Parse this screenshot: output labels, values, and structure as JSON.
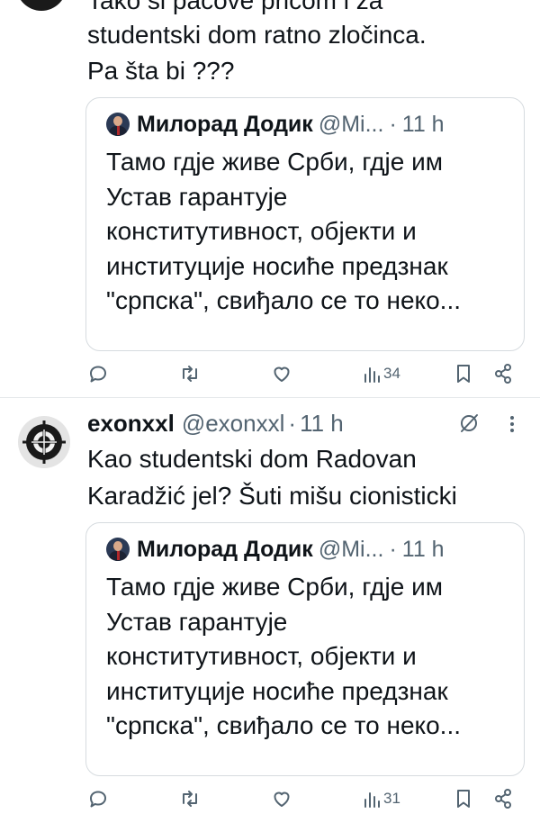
{
  "tweet1": {
    "text_lines": [
      "Tako si pacove pricom i za",
      "studentski dom ratno zločinca.",
      "Pa šta bi ???"
    ],
    "quote": {
      "name": "Милорад Додик",
      "handle": "@Mi...",
      "dot": "·",
      "time": "11 h",
      "lines": [
        "Тамо гдје живе Срби, гдје им",
        "Устав гарантује",
        "конститутивност, објекти и",
        "институције носиће предзнак",
        "\"српска\", свиђало се то неко..."
      ]
    },
    "actions": {
      "views": "34"
    }
  },
  "tweet2": {
    "name": "exonxxl",
    "handle": "@exonxxl",
    "dot": "·",
    "time": "11 h",
    "text_lines": [
      "Kao studentski dom Radovan",
      "Karadžić jel? Šuti mišu cionisticki"
    ],
    "quote": {
      "name": "Милорад Додик",
      "handle": "@Mi...",
      "dot": "·",
      "time": "11 h",
      "lines": [
        "Тамо гдје живе Срби, гдје им",
        "Устав гарантује",
        "конститутивност, објекти и",
        "институције носиће предзнак",
        "\"српска\", свиђало се то неко..."
      ]
    },
    "actions": {
      "views": "31"
    }
  },
  "icons": [
    "reply-icon",
    "retweet-icon",
    "like-icon",
    "views-icon",
    "bookmark-icon",
    "share-icon",
    "grok-icon",
    "more-icon"
  ],
  "colors": {
    "text": "#0f1419",
    "secondary": "#536471",
    "border": "#d6dbdf"
  }
}
